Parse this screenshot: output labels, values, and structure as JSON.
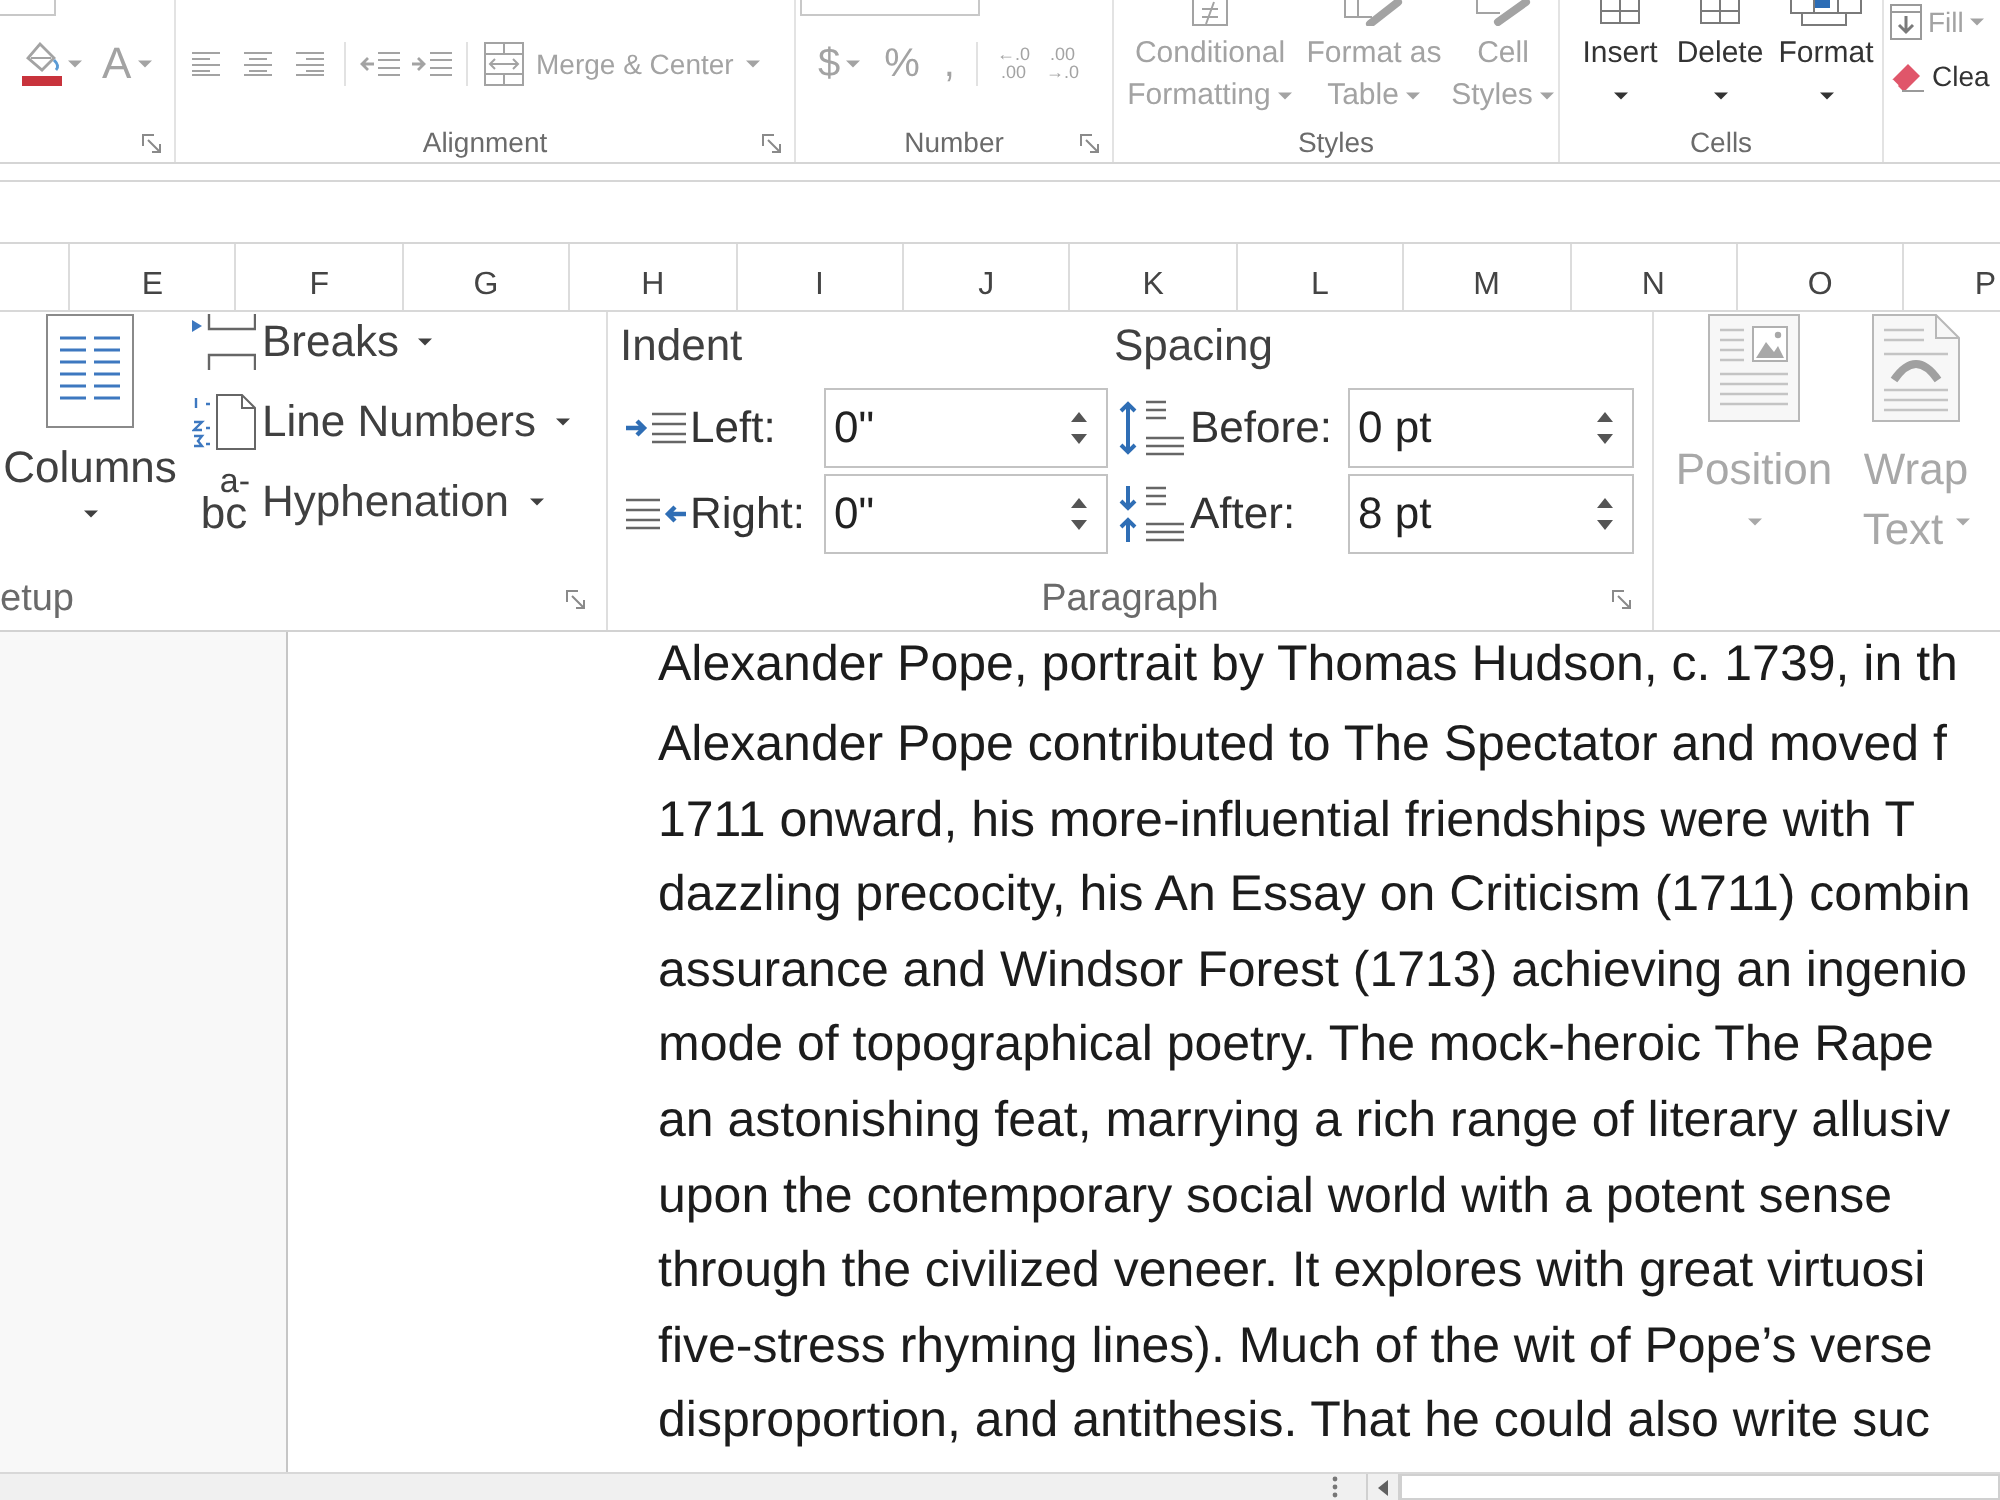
{
  "excel_ribbon": {
    "font_group": {
      "disabled": true,
      "buttons": [
        {
          "kind": "fill-color",
          "dropdown": true
        },
        {
          "kind": "font-color",
          "label": "A",
          "dropdown": true
        }
      ]
    },
    "alignment_group": {
      "label": "Alignment",
      "disabled": true,
      "buttons": [
        {
          "kind": "align-left",
          "dropdown": false
        },
        {
          "kind": "align-center",
          "dropdown": false
        },
        {
          "kind": "align-right",
          "dropdown": false
        },
        {
          "kind": "decrease-indent",
          "dropdown": false
        },
        {
          "kind": "increase-indent",
          "dropdown": false
        },
        {
          "kind": "merge",
          "label": "Merge & Center",
          "dropdown": true
        }
      ]
    },
    "number_group": {
      "label": "Number",
      "disabled": true,
      "buttons": [
        {
          "kind": "symbol",
          "label": "$",
          "dropdown": true
        },
        {
          "kind": "symbol",
          "label": "%",
          "dropdown": false
        },
        {
          "kind": "symbol",
          "label": ",",
          "dropdown": false
        },
        {
          "kind": "decimal",
          "lines": [
            "←.0",
            ".00"
          ],
          "dropdown": false
        },
        {
          "kind": "decimal",
          "lines": [
            ".00",
            "→.0"
          ],
          "dropdown": false
        }
      ]
    },
    "styles_group": {
      "label": "Styles",
      "disabled": true,
      "buttons": [
        {
          "kind": "conditional-formatting",
          "lines": [
            "Conditional",
            "Formatting"
          ],
          "dropdown": true
        },
        {
          "kind": "format-as-table",
          "lines": [
            "Format as",
            "Table"
          ],
          "dropdown": true
        },
        {
          "kind": "cell-styles",
          "lines": [
            "Cell",
            "Styles"
          ],
          "dropdown": true
        }
      ]
    },
    "cells_group": {
      "label": "Cells",
      "disabled": false,
      "buttons": [
        {
          "kind": "insert",
          "lines": [
            "Insert"
          ],
          "dropdown": true
        },
        {
          "kind": "delete",
          "lines": [
            "Delete"
          ],
          "dropdown": true
        },
        {
          "kind": "format",
          "lines": [
            "Format"
          ],
          "dropdown": true
        }
      ]
    },
    "editing_items": [
      {
        "kind": "fill",
        "label": "Fill",
        "disabled": true,
        "dropdown": true
      },
      {
        "kind": "clear",
        "label": "Clea",
        "disabled": false,
        "dropdown": false
      }
    ]
  },
  "column_headers": [
    "E",
    "F",
    "G",
    "H",
    "I",
    "J",
    "K",
    "L",
    "M",
    "N",
    "O",
    "P"
  ],
  "word_ribbon": {
    "page_setup": {
      "label": "etup",
      "columns_button": {
        "label": "Columns",
        "dropdown": true
      },
      "items": [
        {
          "kind": "breaks",
          "label": "Breaks",
          "dropdown": true
        },
        {
          "kind": "line-numbers",
          "label": "Line Numbers",
          "dropdown": true
        },
        {
          "kind": "hyphenation",
          "label": "Hyphenation",
          "icon_text": [
            "a-",
            "bc"
          ],
          "dropdown": true
        }
      ]
    },
    "paragraph": {
      "label": "Paragraph",
      "columns": [
        {
          "heading": "Indent",
          "fields": [
            {
              "kind": "indent-left",
              "label": "Left:",
              "value": "0\""
            },
            {
              "kind": "indent-right",
              "label": "Right:",
              "value": "0\""
            }
          ]
        },
        {
          "heading": "Spacing",
          "fields": [
            {
              "kind": "spacing-before",
              "label": "Before:",
              "value": "0 pt"
            },
            {
              "kind": "spacing-after",
              "label": "After:",
              "value": "8 pt"
            }
          ]
        }
      ]
    },
    "arrange": {
      "disabled": true,
      "buttons": [
        {
          "kind": "position",
          "lines": [
            "Position"
          ],
          "dropdown": true
        },
        {
          "kind": "wrap-text",
          "lines": [
            "Wrap",
            "Text"
          ],
          "dropdown": true
        }
      ]
    }
  },
  "document": {
    "caption": "Alexander Pope, portrait by Thomas Hudson, c. 1739, in th",
    "paragraph_lines": [
      "Alexander Pope contributed to The Spectator and moved f",
      "1711 onward, his more-influential friendships were with T",
      "dazzling precocity, his An Essay on Criticism (1711) combin",
      "assurance and Windsor Forest (1713) achieving an ingenio",
      "mode of topographical poetry. The mock-heroic The Rape",
      "an astonishing feat, marrying a rich range of literary allusiv",
      "upon the contemporary social world with a potent sense",
      "through the civilized veneer. It explores with great virtuosi",
      "five-stress rhyming lines). Much of the wit of Pope’s verse",
      "disproportion, and antithesis. That he could also write suc"
    ]
  }
}
